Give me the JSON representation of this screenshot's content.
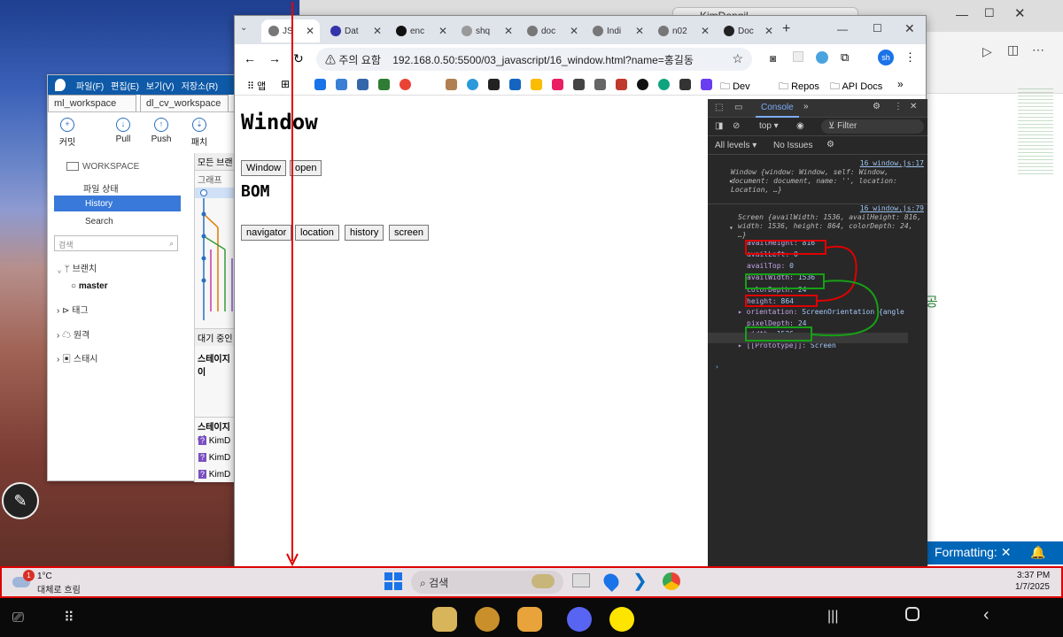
{
  "vscode": {
    "title": "KimDongil",
    "formatting": "Formatting:",
    "right_char": "공"
  },
  "git": {
    "menu": [
      "파일(F)",
      "편집(E)",
      "보기(V)",
      "저장소(R)"
    ],
    "tabs": [
      "ml_workspace",
      "dl_cv_workspace"
    ],
    "toolbar": [
      "커밋",
      "Pull",
      "Push",
      "패치"
    ],
    "workspace": "WORKSPACE",
    "nav": [
      "파일 상태",
      "History",
      "Search"
    ],
    "search_placeholder": "검색",
    "tree": [
      "브랜치",
      "master",
      "태그",
      "원격",
      "스태시"
    ],
    "right_labels": [
      "모든 브랜",
      "그래프",
      "대기 중인",
      "스테이지이",
      "스테이지이"
    ],
    "files": [
      "KimD",
      "KimD",
      "KimD"
    ]
  },
  "chrome": {
    "tabs": [
      {
        "label": "JS",
        "active": true
      },
      {
        "label": "Dat"
      },
      {
        "label": "enc"
      },
      {
        "label": "shq"
      },
      {
        "label": "doc"
      },
      {
        "label": "Indi"
      },
      {
        "label": "n02"
      },
      {
        "label": "Doc"
      }
    ],
    "security": "주의 요함",
    "url": "192.168.0.50:5500/03_javascript/16_window.html?name=홍길동",
    "bookmarks_folders": [
      "Dev",
      "Repos",
      "API Docs"
    ],
    "apps_label": "앱",
    "profile": "sh",
    "page": {
      "h1": "Window",
      "h1_buttons": [
        "Window",
        "open"
      ],
      "h2": "BOM",
      "h2_buttons": [
        "navigator",
        "location",
        "history",
        "screen"
      ]
    },
    "devtools": {
      "tab": "Console",
      "context": "top",
      "filter": "Filter",
      "levels": "All levels",
      "issues": "No Issues",
      "log1_src": "16_window.js:17",
      "log1": "Window {window: Window, self: Window, document: document, name: '', location: Location, …}",
      "log2_src": "16_window.js:79",
      "log2": "Screen {availWidth: 1536, availHeight: 816, width: 1536, height: 864, colorDepth: 24, …}",
      "props": [
        {
          "k": "availHeight",
          "v": "816"
        },
        {
          "k": "availLeft",
          "v": "0"
        },
        {
          "k": "availTop",
          "v": "0"
        },
        {
          "k": "availWidth",
          "v": "1536"
        },
        {
          "k": "colorDepth",
          "v": "24"
        },
        {
          "k": "height",
          "v": "864"
        },
        {
          "k": "orientation",
          "v": "ScreenOrientation {angle"
        },
        {
          "k": "pixelDepth",
          "v": "24"
        },
        {
          "k": "width",
          "v": "1536"
        },
        {
          "k": "[[Prototype]]",
          "v": "Screen"
        }
      ]
    }
  },
  "taskbar": {
    "weather_temp": "1°C",
    "weather_desc": "대체로 흐림",
    "badge": "1",
    "search": "검색",
    "time": "3:37 PM",
    "date": "1/7/2025"
  },
  "colors": {
    "red_annotation": "#e00000",
    "green_annotation": "#16a016",
    "accent": "#0066b8"
  }
}
